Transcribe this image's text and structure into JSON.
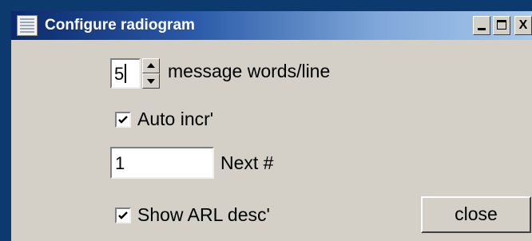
{
  "window": {
    "title": "Configure radiogram",
    "controls": {
      "close_glyph": "X"
    }
  },
  "words_per_line": {
    "value": "5",
    "label": "message words/line"
  },
  "auto_incr": {
    "checked": true,
    "label": "Auto incr'"
  },
  "next_number": {
    "value": "1",
    "label": "Next #"
  },
  "show_arl_desc": {
    "checked": true,
    "label": "Show ARL desc'"
  },
  "buttons": {
    "close_label": "close"
  },
  "colors": {
    "desktop_background": "#0c3a6e",
    "client_background": "#d4d0c8",
    "titlebar_start": "#0c2a6a",
    "titlebar_end": "#a8c8ec"
  },
  "icons": {
    "app": "radiogram-app-icon",
    "minimize": "minimize-icon",
    "maximize": "maximize-icon",
    "close": "close-icon",
    "spin_up": "arrow-up-icon",
    "spin_down": "arrow-down-icon",
    "check": "checkmark-icon"
  }
}
